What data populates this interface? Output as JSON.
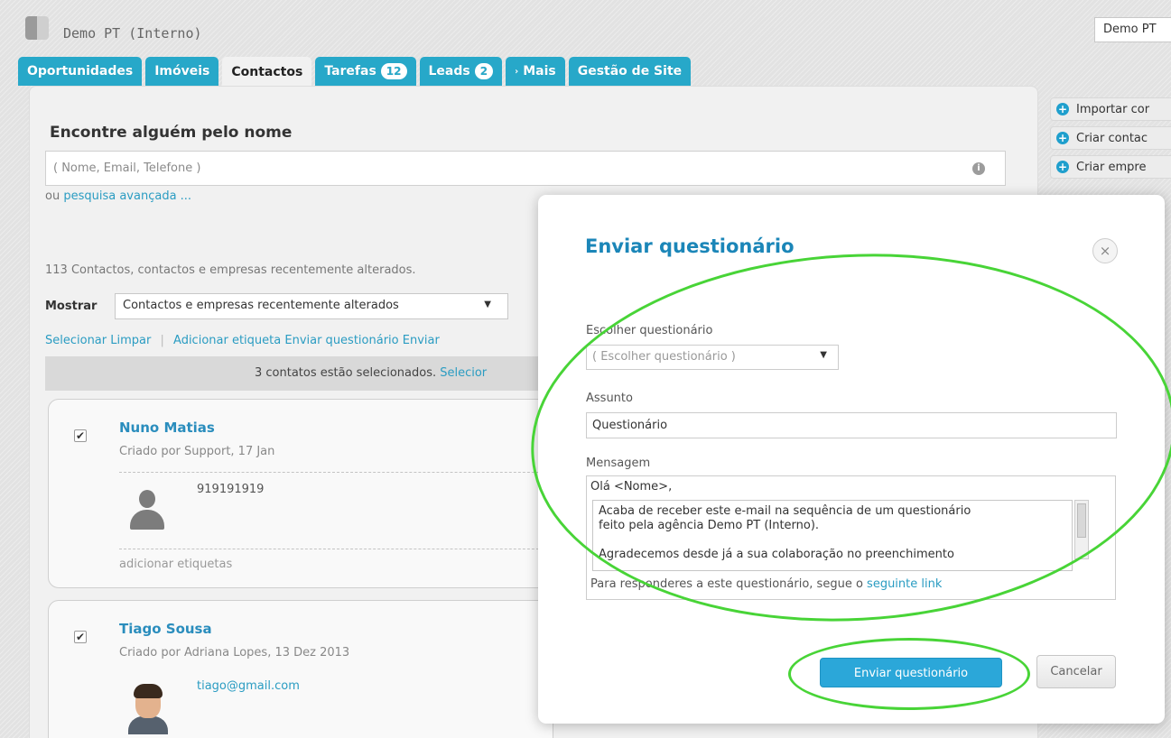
{
  "header": {
    "agency_title": "Demo PT (Interno)",
    "user_name": "Demo PT"
  },
  "tabs": [
    {
      "label": "Oportunidades"
    },
    {
      "label": "Imóveis"
    },
    {
      "label": "Contactos",
      "active": true
    },
    {
      "label": "Tarefas",
      "badge": "12"
    },
    {
      "label": "Leads",
      "badge": "2"
    },
    {
      "label": "Mais"
    },
    {
      "label": "Gestão de Site"
    }
  ],
  "find": {
    "title": "Encontre alguém pelo nome",
    "placeholder": "( Nome, Email, Telefone )",
    "advanced_prefix": "ou",
    "advanced_link": "pesquisa avançada ..."
  },
  "list": {
    "count_text": "113 Contactos, contactos e empresas recentemente alterados.",
    "show_label": "Mostrar",
    "show_value": "Contactos e empresas recentemente alterados",
    "actions": [
      "Selecionar",
      "Limpar",
      "Adicionar etiqueta",
      "Enviar questionário",
      "Enviar"
    ],
    "selected_text": "3 contatos estão selecionados.",
    "selected_link": "Selecior"
  },
  "contacts": [
    {
      "name": "Nuno Matias",
      "created": "Criado por Support, 17 Jan",
      "phone": "919191919",
      "tags_link": "adicionar etiquetas"
    },
    {
      "name": "Tiago Sousa",
      "created": "Criado por Adriana Lopes, 13 Dez 2013",
      "email": "tiago@gmail.com"
    }
  ],
  "side_buttons": [
    "Importar cor",
    "Criar contac",
    "Criar empre"
  ],
  "modal": {
    "title": "Enviar questionário",
    "close_label": "×",
    "choose_label": "Escolher questionário",
    "choose_value": "( Escolher questionário )",
    "subject_label": "Assunto",
    "subject_value": "Questionário",
    "message_label": "Mensagem",
    "message_greeting": "Olá <Nome>,",
    "message_p1_line1": "Acaba de receber este e-mail na sequência de um questionário",
    "message_p1_line2": "feito pela agência Demo PT (Interno).",
    "message_p2": "Agradecemos desde já a sua colaboração no preenchimento",
    "message_footer": "Para responderes a este questionário, segue o",
    "message_link": "seguinte link",
    "send_label": "Enviar questionário",
    "cancel_label": "Cancelar"
  },
  "colors": {
    "tab_blue": "#27a8c9",
    "title_blue": "#1b86b8",
    "link_blue": "#2a9cc2",
    "highlight_green": "#48d437",
    "send_button": "#2ba7d9"
  }
}
